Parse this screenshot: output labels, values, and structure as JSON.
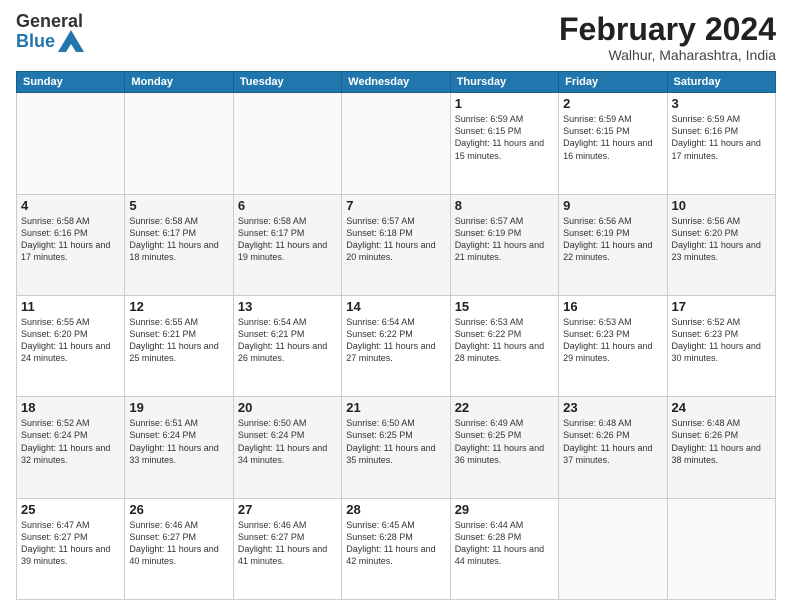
{
  "logo": {
    "general": "General",
    "blue": "Blue"
  },
  "title": {
    "month_year": "February 2024",
    "location": "Walhur, Maharashtra, India"
  },
  "weekdays": [
    "Sunday",
    "Monday",
    "Tuesday",
    "Wednesday",
    "Thursday",
    "Friday",
    "Saturday"
  ],
  "weeks": [
    [
      {
        "day": "",
        "info": ""
      },
      {
        "day": "",
        "info": ""
      },
      {
        "day": "",
        "info": ""
      },
      {
        "day": "",
        "info": ""
      },
      {
        "day": "1",
        "info": "Sunrise: 6:59 AM\nSunset: 6:15 PM\nDaylight: 11 hours\nand 15 minutes."
      },
      {
        "day": "2",
        "info": "Sunrise: 6:59 AM\nSunset: 6:15 PM\nDaylight: 11 hours\nand 16 minutes."
      },
      {
        "day": "3",
        "info": "Sunrise: 6:59 AM\nSunset: 6:16 PM\nDaylight: 11 hours\nand 17 minutes."
      }
    ],
    [
      {
        "day": "4",
        "info": "Sunrise: 6:58 AM\nSunset: 6:16 PM\nDaylight: 11 hours\nand 17 minutes."
      },
      {
        "day": "5",
        "info": "Sunrise: 6:58 AM\nSunset: 6:17 PM\nDaylight: 11 hours\nand 18 minutes."
      },
      {
        "day": "6",
        "info": "Sunrise: 6:58 AM\nSunset: 6:17 PM\nDaylight: 11 hours\nand 19 minutes."
      },
      {
        "day": "7",
        "info": "Sunrise: 6:57 AM\nSunset: 6:18 PM\nDaylight: 11 hours\nand 20 minutes."
      },
      {
        "day": "8",
        "info": "Sunrise: 6:57 AM\nSunset: 6:19 PM\nDaylight: 11 hours\nand 21 minutes."
      },
      {
        "day": "9",
        "info": "Sunrise: 6:56 AM\nSunset: 6:19 PM\nDaylight: 11 hours\nand 22 minutes."
      },
      {
        "day": "10",
        "info": "Sunrise: 6:56 AM\nSunset: 6:20 PM\nDaylight: 11 hours\nand 23 minutes."
      }
    ],
    [
      {
        "day": "11",
        "info": "Sunrise: 6:55 AM\nSunset: 6:20 PM\nDaylight: 11 hours\nand 24 minutes."
      },
      {
        "day": "12",
        "info": "Sunrise: 6:55 AM\nSunset: 6:21 PM\nDaylight: 11 hours\nand 25 minutes."
      },
      {
        "day": "13",
        "info": "Sunrise: 6:54 AM\nSunset: 6:21 PM\nDaylight: 11 hours\nand 26 minutes."
      },
      {
        "day": "14",
        "info": "Sunrise: 6:54 AM\nSunset: 6:22 PM\nDaylight: 11 hours\nand 27 minutes."
      },
      {
        "day": "15",
        "info": "Sunrise: 6:53 AM\nSunset: 6:22 PM\nDaylight: 11 hours\nand 28 minutes."
      },
      {
        "day": "16",
        "info": "Sunrise: 6:53 AM\nSunset: 6:23 PM\nDaylight: 11 hours\nand 29 minutes."
      },
      {
        "day": "17",
        "info": "Sunrise: 6:52 AM\nSunset: 6:23 PM\nDaylight: 11 hours\nand 30 minutes."
      }
    ],
    [
      {
        "day": "18",
        "info": "Sunrise: 6:52 AM\nSunset: 6:24 PM\nDaylight: 11 hours\nand 32 minutes."
      },
      {
        "day": "19",
        "info": "Sunrise: 6:51 AM\nSunset: 6:24 PM\nDaylight: 11 hours\nand 33 minutes."
      },
      {
        "day": "20",
        "info": "Sunrise: 6:50 AM\nSunset: 6:24 PM\nDaylight: 11 hours\nand 34 minutes."
      },
      {
        "day": "21",
        "info": "Sunrise: 6:50 AM\nSunset: 6:25 PM\nDaylight: 11 hours\nand 35 minutes."
      },
      {
        "day": "22",
        "info": "Sunrise: 6:49 AM\nSunset: 6:25 PM\nDaylight: 11 hours\nand 36 minutes."
      },
      {
        "day": "23",
        "info": "Sunrise: 6:48 AM\nSunset: 6:26 PM\nDaylight: 11 hours\nand 37 minutes."
      },
      {
        "day": "24",
        "info": "Sunrise: 6:48 AM\nSunset: 6:26 PM\nDaylight: 11 hours\nand 38 minutes."
      }
    ],
    [
      {
        "day": "25",
        "info": "Sunrise: 6:47 AM\nSunset: 6:27 PM\nDaylight: 11 hours\nand 39 minutes."
      },
      {
        "day": "26",
        "info": "Sunrise: 6:46 AM\nSunset: 6:27 PM\nDaylight: 11 hours\nand 40 minutes."
      },
      {
        "day": "27",
        "info": "Sunrise: 6:46 AM\nSunset: 6:27 PM\nDaylight: 11 hours\nand 41 minutes."
      },
      {
        "day": "28",
        "info": "Sunrise: 6:45 AM\nSunset: 6:28 PM\nDaylight: 11 hours\nand 42 minutes."
      },
      {
        "day": "29",
        "info": "Sunrise: 6:44 AM\nSunset: 6:28 PM\nDaylight: 11 hours\nand 44 minutes."
      },
      {
        "day": "",
        "info": ""
      },
      {
        "day": "",
        "info": ""
      }
    ]
  ]
}
